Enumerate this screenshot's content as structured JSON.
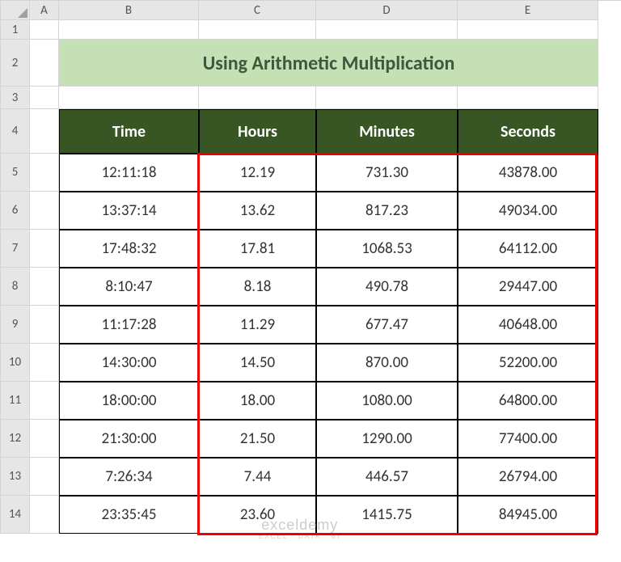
{
  "cols": [
    "A",
    "B",
    "C",
    "D",
    "E"
  ],
  "rows": [
    "1",
    "2",
    "3",
    "4",
    "5",
    "6",
    "7",
    "8",
    "9",
    "10",
    "11",
    "12",
    "13",
    "14"
  ],
  "title": "Using Arithmetic Multiplication",
  "headers": [
    "Time",
    "Hours",
    "Minutes",
    "Seconds"
  ],
  "chart_data": {
    "type": "table",
    "title": "Using Arithmetic Multiplication",
    "columns": [
      "Time",
      "Hours",
      "Minutes",
      "Seconds"
    ],
    "rows": [
      {
        "Time": "12:11:18",
        "Hours": "12.19",
        "Minutes": "731.30",
        "Seconds": "43878.00"
      },
      {
        "Time": "13:37:14",
        "Hours": "13.62",
        "Minutes": "817.23",
        "Seconds": "49034.00"
      },
      {
        "Time": "17:48:32",
        "Hours": "17.81",
        "Minutes": "1068.53",
        "Seconds": "64112.00"
      },
      {
        "Time": "8:10:47",
        "Hours": "8.18",
        "Minutes": "490.78",
        "Seconds": "29447.00"
      },
      {
        "Time": "11:17:28",
        "Hours": "11.29",
        "Minutes": "677.47",
        "Seconds": "40648.00"
      },
      {
        "Time": "14:30:00",
        "Hours": "14.50",
        "Minutes": "870.00",
        "Seconds": "52200.00"
      },
      {
        "Time": "18:00:00",
        "Hours": "18.00",
        "Minutes": "1080.00",
        "Seconds": "64800.00"
      },
      {
        "Time": "21:30:00",
        "Hours": "21.50",
        "Minutes": "1290.00",
        "Seconds": "77400.00"
      },
      {
        "Time": "7:26:34",
        "Hours": "7.44",
        "Minutes": "446.57",
        "Seconds": "26794.00"
      },
      {
        "Time": "23:35:45",
        "Hours": "23.60",
        "Minutes": "1415.75",
        "Seconds": "84945.00"
      }
    ]
  },
  "watermark": {
    "line1": "exceldemy",
    "line2": "EXCEL · DATA · BI"
  }
}
